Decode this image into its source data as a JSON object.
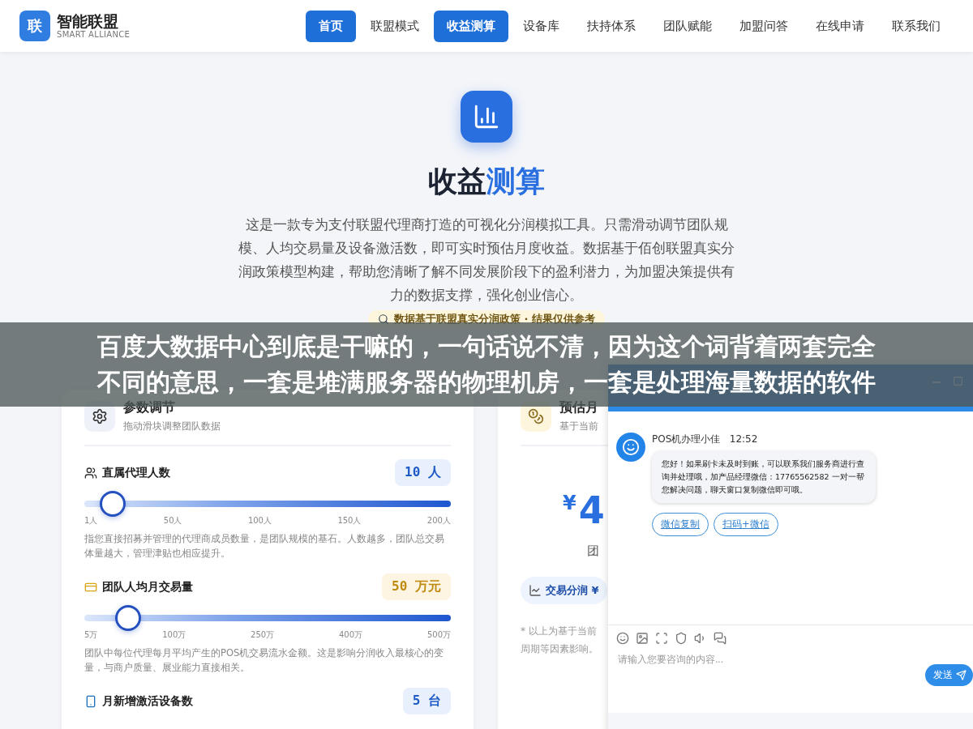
{
  "header": {
    "logo_mark": "联",
    "brand": "智能联盟",
    "brand_sub": "SMART ALLIANCE",
    "nav": [
      {
        "label": "首页",
        "selected": true
      },
      {
        "label": "联盟模式",
        "selected": false
      },
      {
        "label": "收益测算",
        "selected": true
      },
      {
        "label": "设备库",
        "selected": false
      },
      {
        "label": "扶持体系",
        "selected": false
      },
      {
        "label": "团队赋能",
        "selected": false
      },
      {
        "label": "加盟问答",
        "selected": false
      },
      {
        "label": "在线申请",
        "selected": false
      },
      {
        "label": "联系我们",
        "selected": false
      }
    ]
  },
  "hero": {
    "title": "收益",
    "title_accent": "测算",
    "description": "这是一款专为支付联盟代理商打造的可视化分润模拟工具。只需滑动调节团队规模、人均交易量及设备激活数，即可实时预估月度收益。数据基于佰创联盟真实分润政策模型构建，帮助您清晰了解不同发展阶段下的盈利潜力，为加盟决策提供有力的数据支撑，强化创业信心。",
    "note": "数据基于联盟真实分润政策 · 结果仅供参考"
  },
  "params_card": {
    "title": "参数调节",
    "subtitle": "拖动滑块调整团队数据",
    "rows": [
      {
        "kind": "people",
        "label": "直属代理人数",
        "value": "10 人",
        "level": 0.077,
        "ticks": [
          "1人",
          "50人",
          "100人",
          "150人",
          "200人"
        ],
        "description": "指您直接招募并管理的代理商成员数量，是团队规模的基石。人数越多，团队总交易体量越大，管理津贴也相应提升。"
      },
      {
        "kind": "card",
        "label": "团队人均月交易量",
        "value": "50 万元",
        "level": 0.119,
        "ticks": [
          "5万",
          "100万",
          "250万",
          "400万",
          "500万"
        ],
        "description": "团队中每位代理每月平均产生的POS机交易流水金额。这是影响分润收入最核心的变量，与商户质量、展业能力直接相关。"
      },
      {
        "kind": "phone",
        "label": "月新增激活设备数",
        "value": "5 台"
      }
    ]
  },
  "estimate_card": {
    "title": "预估月",
    "subtitle": "基于当前",
    "currency": "¥",
    "amount": "4",
    "caption": "团",
    "share_chip": "交易分润 ¥",
    "footnote_lines": [
      "* 以上为基于当前",
      "周期等因素影响。"
    ]
  },
  "chat": {
    "agent": "POS机办理小佳",
    "time": "12:52",
    "message": "您好！如果刷卡未及时到账，可以联系我们服务商进行查询并处理哦，加产品经理微信：17765562582 一对一帮您解决问题，聊天窗口复制微信即可哦。",
    "actions": [
      "微信复制",
      "扫码+微信"
    ],
    "input_placeholder": "请输入您要咨询的内容...",
    "send": "发送"
  },
  "overlay_caption": {
    "lines": [
      "百度大数据中心到底是干嘛的，一句话说不清，因为这个词背着两套完全",
      "不同的意思，一套是堆满服务器的物理机房，一套是处理海量数据的软件"
    ]
  }
}
